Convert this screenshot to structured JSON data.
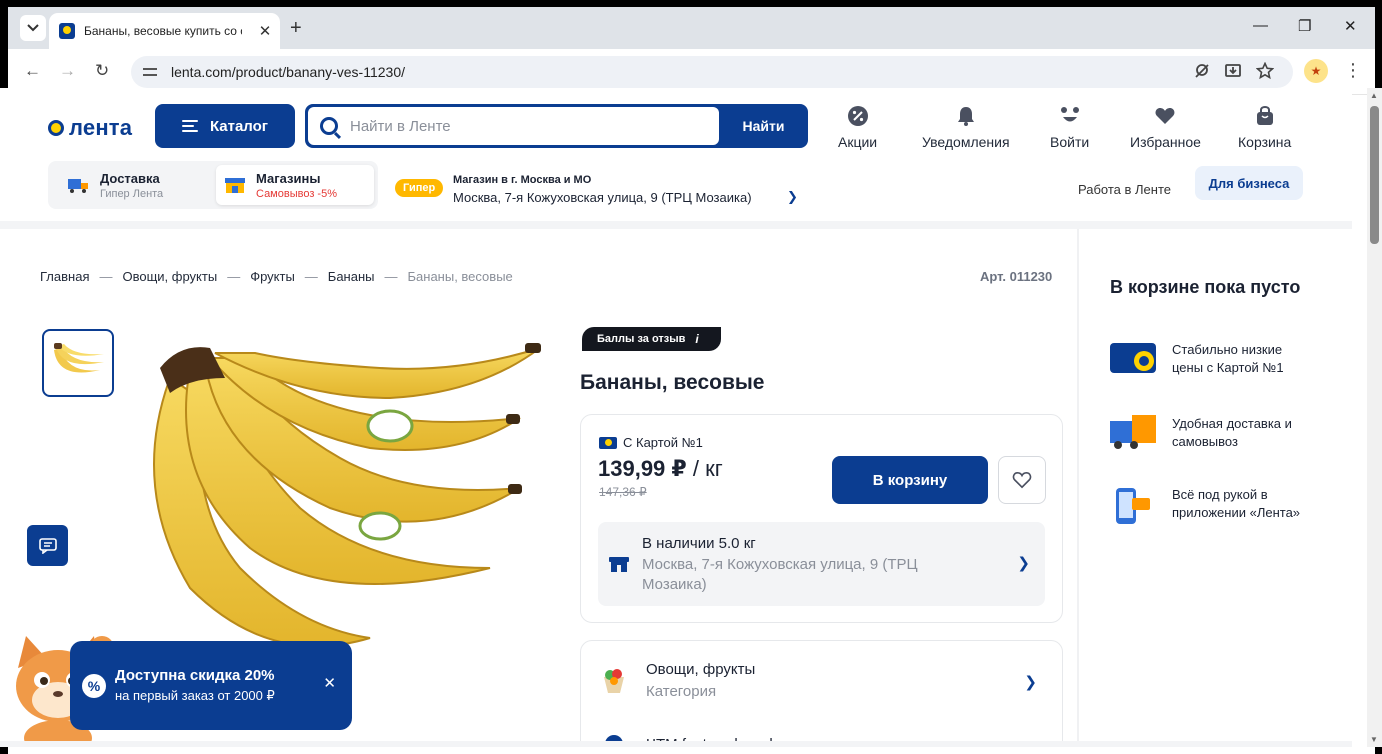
{
  "browser": {
    "tab_title": "Бананы, весовые купить со ск",
    "url": "lenta.com/product/banany-ves-11230/",
    "new_tab": "+",
    "close_tab": "✕",
    "minimize": "—",
    "restore": "❐",
    "close_window": "✕",
    "back": "←",
    "forward": "→",
    "reload": "↻"
  },
  "header": {
    "logo": "лента",
    "catalog_label": "Каталог",
    "search_placeholder": "Найти в Ленте",
    "search_button": "Найти",
    "actions": [
      {
        "label": "Акции",
        "icon": "percent-icon"
      },
      {
        "label": "Уведомления",
        "icon": "bell-icon"
      },
      {
        "label": "Войти",
        "icon": "face-icon"
      },
      {
        "label": "Избранное",
        "icon": "heart-icon"
      },
      {
        "label": "Корзина",
        "icon": "bag-icon"
      }
    ],
    "delivery": {
      "title": "Доставка",
      "sub": "Гипер Лента"
    },
    "stores": {
      "title": "Магазины",
      "sub": "Самовывоз -5%"
    },
    "store_badge": "Гипер",
    "store_title": "Магазин в г. Москва и МО",
    "store_address": "Москва, 7-я Кожуховская улица, 9 (ТРЦ Мозаика)",
    "work_link": "Работа в Ленте",
    "business_button": "Для бизнеса"
  },
  "breadcrumb": {
    "items": [
      "Главная",
      "Овощи, фрукты",
      "Фрукты",
      "Бананы"
    ],
    "separator": "—",
    "current": "Бананы, весовые"
  },
  "product": {
    "article": "Арт. 011230",
    "reviews_badge": "Баллы за отзыв",
    "reviews_info": "i",
    "title": "Бананы, весовые",
    "card_label": "С Картой №1",
    "price": "139,99 ₽",
    "unit": "/ кг",
    "old_price": "147,36 ₽",
    "cart_button": "В корзину",
    "stock_title": "В наличии 5.0 кг",
    "stock_address": "Москва, 7-я Кожуховская улица, 9 (ТРЦ Мозаика)",
    "category_title": "Овощи, фрукты",
    "category_sub": "Категория",
    "brand_title": "ЧТМ fantasy brands"
  },
  "sidebar": {
    "title": "В корзине пока пусто",
    "benefits": [
      "Стабильно низкие цены с Картой №1",
      "Удобная доставка и самовывоз",
      "Всё под рукой в приложении «Лента»"
    ]
  },
  "promo": {
    "title": "Доступна скидка 20%",
    "sub": "на первый заказ от 2000 ₽",
    "icon": "%",
    "close": "✕"
  },
  "colors": {
    "brand_blue": "#0b3d91",
    "brand_yellow": "#ffd200",
    "giper_orange": "#ffb800",
    "discount_red": "#e53935"
  }
}
